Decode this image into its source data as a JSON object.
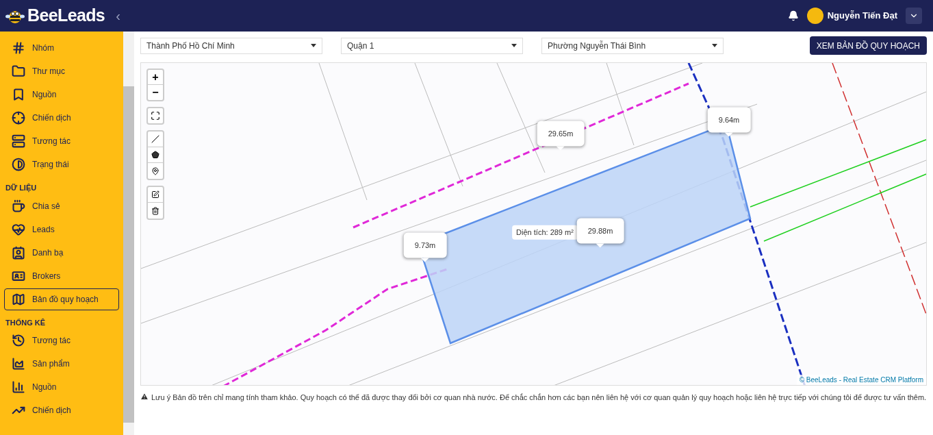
{
  "header": {
    "brand": "BeeLeads",
    "collapse": "‹",
    "user_name": "Nguyễn Tiến Đạt"
  },
  "sidebar": {
    "groups": [
      {
        "items": [
          {
            "label": "Nhóm",
            "selected": false
          },
          {
            "label": "Thư mục",
            "selected": false
          },
          {
            "label": "Nguồn",
            "selected": false
          },
          {
            "label": "Chiến dịch",
            "selected": false
          },
          {
            "label": "Tương tác",
            "selected": false
          },
          {
            "label": "Trạng thái",
            "selected": false
          }
        ]
      },
      {
        "title": "DỮ LIỆU",
        "items": [
          {
            "label": "Chia sẻ",
            "selected": false
          },
          {
            "label": "Leads",
            "selected": false
          },
          {
            "label": "Danh bạ",
            "selected": false
          },
          {
            "label": "Brokers",
            "selected": false
          },
          {
            "label": "Bản đồ quy hoạch",
            "selected": true
          }
        ]
      },
      {
        "title": "THỐNG KÊ",
        "items": [
          {
            "label": "Tương tác",
            "selected": false
          },
          {
            "label": "Sản phẩm",
            "selected": false
          },
          {
            "label": "Nguồn",
            "selected": false
          },
          {
            "label": "Chiến dịch",
            "selected": false
          }
        ]
      }
    ]
  },
  "filters": [
    {
      "value": "Thành Phố Hồ Chí Minh"
    },
    {
      "value": "Quận 1"
    },
    {
      "value": "Phường Nguyễn Thái Bình"
    }
  ],
  "view_button": "XEM BẢN ĐỒ QUY HOẠCH",
  "map": {
    "zoom_in": "+",
    "zoom_out": "−",
    "tooltips": [
      {
        "text": "29.65m",
        "kind": "pointer"
      },
      {
        "text": "9.64m",
        "kind": "pointer"
      },
      {
        "text": "Diện tích: 289 m²",
        "kind": "plain"
      },
      {
        "text": "29.88m",
        "kind": "pointer"
      },
      {
        "text": "9.73m",
        "kind": "pointer"
      }
    ],
    "attribution": "© BeeLeads - Real Estate CRM Platform"
  },
  "notice": "Lưu ý Bản đồ trên chỉ mang tính tham khảo. Quy hoạch có thể đã được thay đổi bởi cơ quan nhà nước. Để chắc chắn hơn các bạn nên liên hệ với cơ quan quản lý quy hoạch hoặc liên hệ trực tiếp với chúng tôi để được tư vấn thêm."
}
